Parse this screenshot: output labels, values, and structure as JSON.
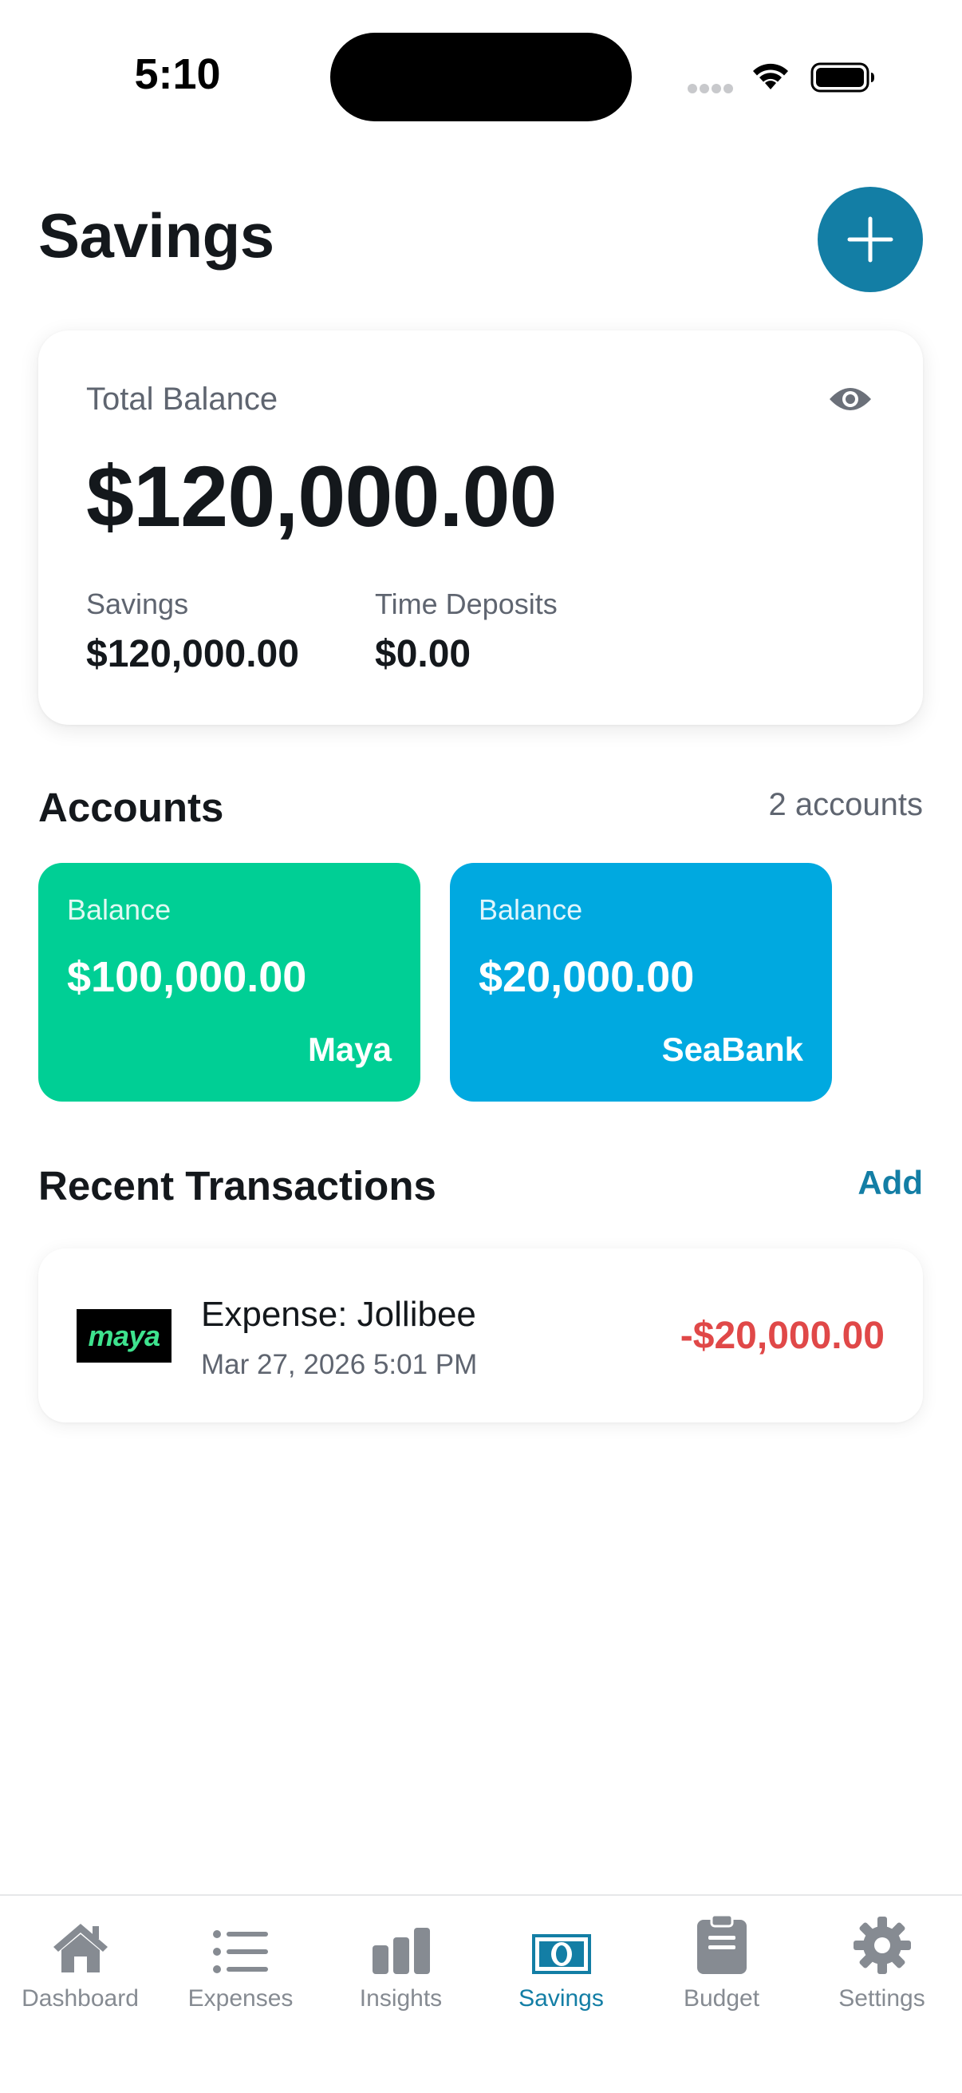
{
  "status_bar": {
    "time": "5:10"
  },
  "header": {
    "title": "Savings",
    "add_button_icon": "plus-icon"
  },
  "balance_card": {
    "label": "Total Balance",
    "amount": "$120,000.00",
    "visibility_icon": "eye-icon",
    "breakdown": [
      {
        "label": "Savings",
        "value": "$120,000.00"
      },
      {
        "label": "Time Deposits",
        "value": "$0.00"
      }
    ]
  },
  "accounts": {
    "title": "Accounts",
    "count": "2 accounts",
    "items": [
      {
        "label": "Balance",
        "amount": "$100,000.00",
        "name": "Maya",
        "color": "#00cf95"
      },
      {
        "label": "Balance",
        "amount": "$20,000.00",
        "name": "SeaBank",
        "color": "#00a9e0"
      }
    ]
  },
  "transactions": {
    "title": "Recent Transactions",
    "add_label": "Add",
    "items": [
      {
        "logo_text": "maya",
        "title": "Expense: Jollibee",
        "date": "Mar 27, 2026 5:01 PM",
        "amount": "-$20,000.00"
      }
    ]
  },
  "tab_bar": {
    "active": "Savings",
    "items": [
      {
        "label": "Dashboard",
        "icon": "home-icon"
      },
      {
        "label": "Expenses",
        "icon": "list-icon"
      },
      {
        "label": "Insights",
        "icon": "bar-chart-icon"
      },
      {
        "label": "Savings",
        "icon": "banknote-icon"
      },
      {
        "label": "Budget",
        "icon": "clipboard-icon"
      },
      {
        "label": "Settings",
        "icon": "gear-icon"
      }
    ]
  },
  "colors": {
    "accent": "#137ea5",
    "negative": "#e04848",
    "tab_inactive": "#868b92"
  }
}
